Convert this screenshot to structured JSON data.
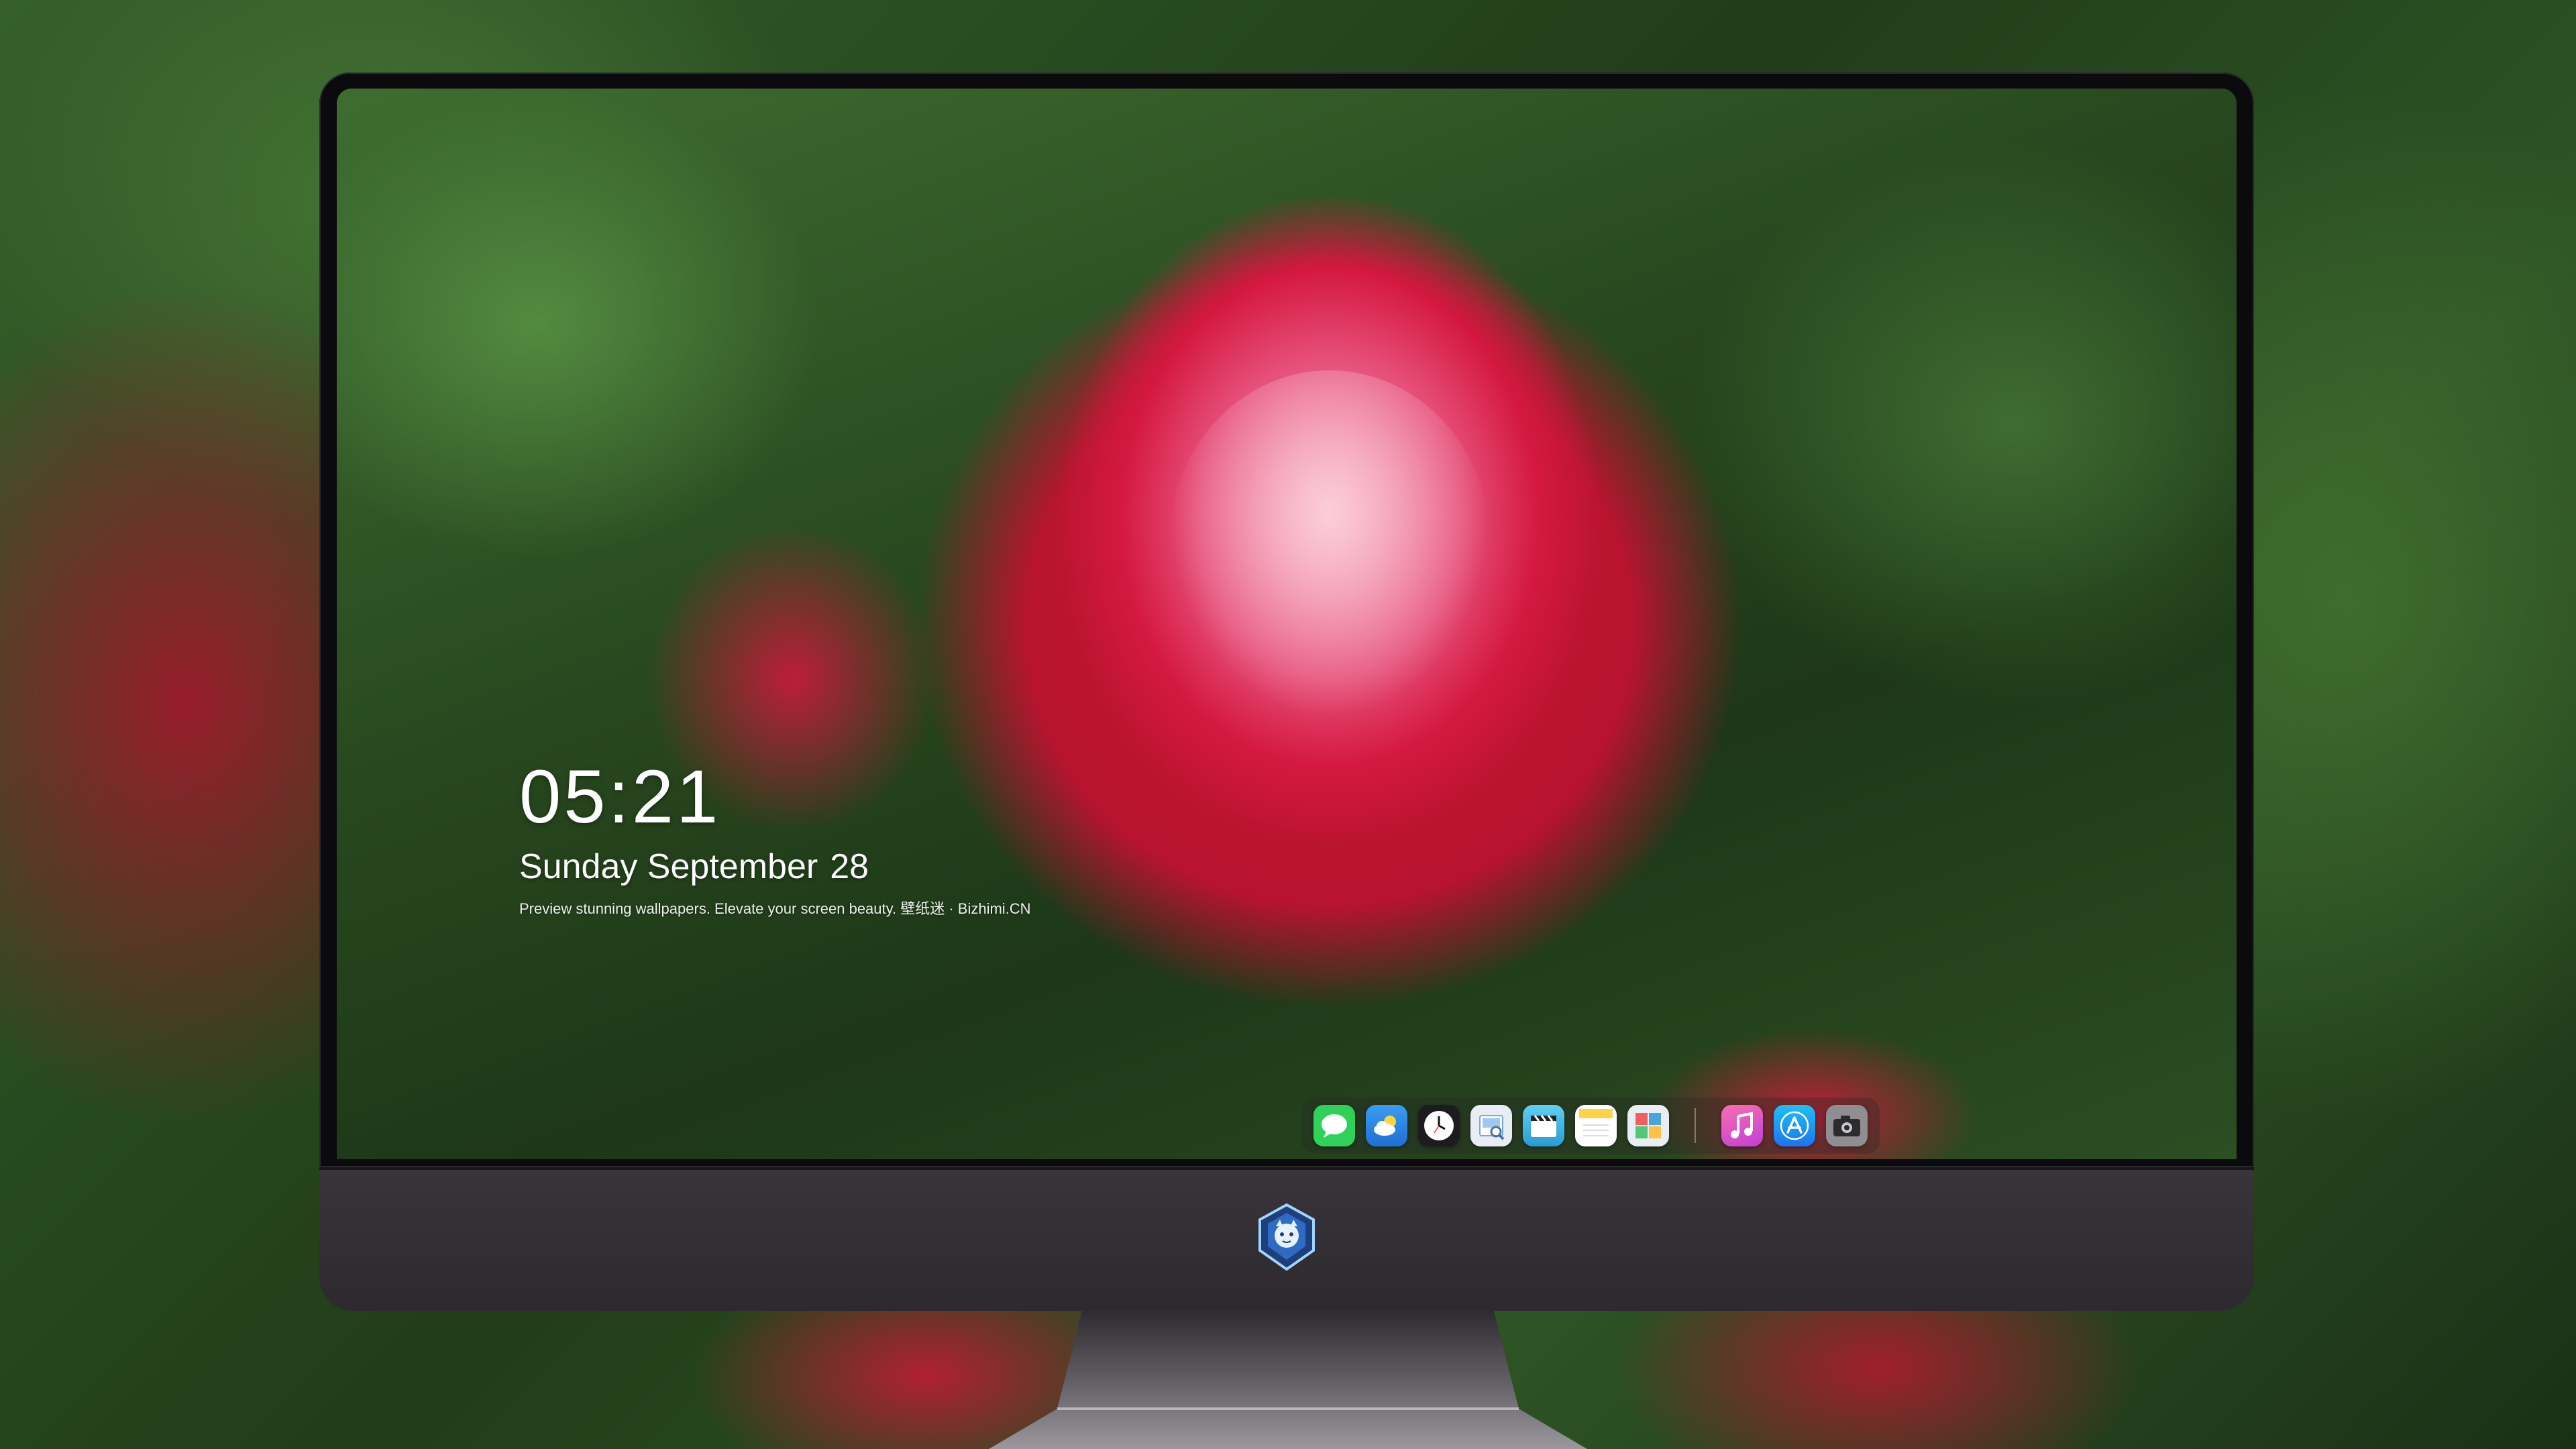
{
  "lock_screen": {
    "time": "05:21",
    "weekday_month": "Sunday September",
    "day": "28",
    "tagline": "Preview stunning wallpapers. Elevate your screen beauty. 壁纸迷 · Bizhimi.CN"
  },
  "dock": {
    "apps": [
      {
        "name": "messages-icon",
        "color": "#30d158"
      },
      {
        "name": "weather-icon",
        "color": "#3a9df0"
      },
      {
        "name": "clock-icon",
        "color": "#1c1c1e"
      },
      {
        "name": "preview-icon",
        "color": "#e8edf5"
      },
      {
        "name": "clips-icon",
        "color": "#3fb9e8"
      },
      {
        "name": "notes-icon",
        "color": "#ffd24a"
      },
      {
        "name": "photo-booth-icon",
        "color": "#e9eef3"
      },
      {
        "name": "music-icon",
        "color": "#f0428c"
      },
      {
        "name": "app-store-icon",
        "color": "#1d8cf4"
      },
      {
        "name": "screenshot-icon",
        "color": "#6e6e73"
      }
    ]
  },
  "colors": {
    "bezel": "#0b0b0d",
    "chin": "#38343a",
    "rose": "#d4183f",
    "foliage": "#28481f"
  }
}
